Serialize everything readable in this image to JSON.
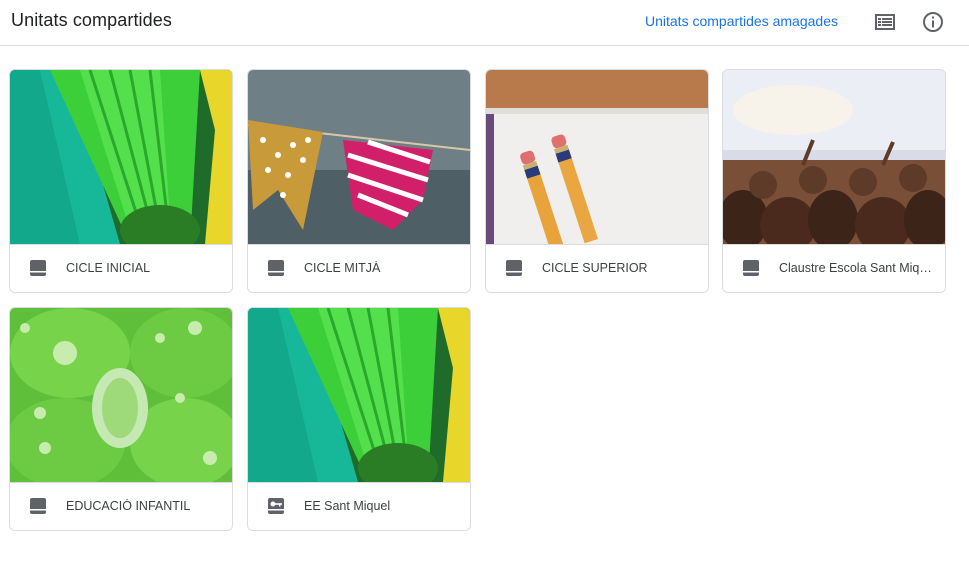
{
  "header": {
    "title": "Unitats compartides",
    "hidden_link": "Unitats compartides amagades",
    "list_view_icon": "list-view-icon",
    "info_icon": "info-icon"
  },
  "drives": [
    {
      "name": "CICLE INICIAL",
      "icon": "shared-drive-icon",
      "theme": "green-pencils"
    },
    {
      "name": "CICLE MITJÀ",
      "icon": "shared-drive-icon",
      "theme": "bunting-flags"
    },
    {
      "name": "CICLE SUPERIOR",
      "icon": "shared-drive-icon",
      "theme": "pencils-notebook"
    },
    {
      "name": "Claustre Escola Sant Miquel",
      "icon": "shared-drive-icon",
      "theme": "concert-crowd"
    },
    {
      "name": "EDUCACIÓ INFANTIL",
      "icon": "shared-drive-icon",
      "theme": "clover-drops"
    },
    {
      "name": "EE Sant Miquel",
      "icon": "restricted-drive-icon",
      "theme": "green-pencils"
    }
  ],
  "colors": {
    "accent": "#1a73e8",
    "border": "#dadce0",
    "icon": "#5f6368",
    "text": "#3c4043"
  }
}
